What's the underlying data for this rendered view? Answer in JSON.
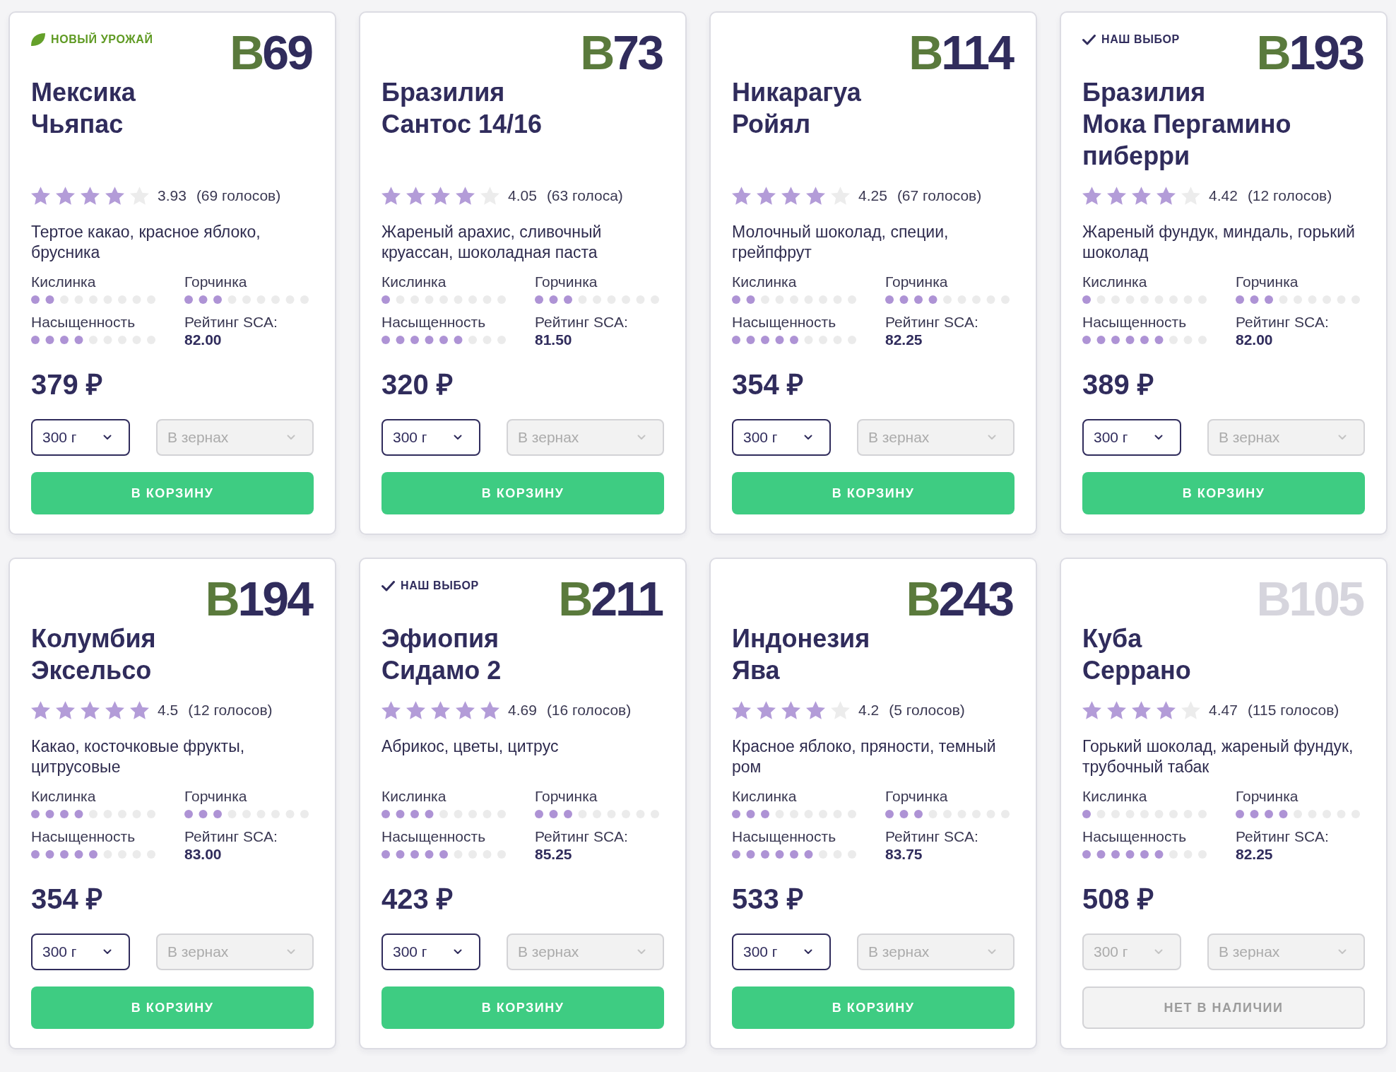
{
  "products": [
    {
      "badge": {
        "kind": "new_harvest",
        "label": "НОВЫЙ УРОЖАЙ"
      },
      "series": "B",
      "number": "69",
      "country": "Мексика",
      "name": "Чьяпас",
      "stars": 4,
      "rating": "3.93",
      "votes": "(69 голосов)",
      "description": "Тертое какао, красное яблоко, брусника",
      "attributes": [
        {
          "kind": "meter",
          "label": "Кислинка",
          "level": 0.2222
        },
        {
          "kind": "meter",
          "label": "Горчинка",
          "level": 0.3333
        },
        {
          "kind": "meter",
          "label": "Насыщенность",
          "level": 0.4444
        },
        {
          "kind": "score",
          "label": "Рейтинг SCA:",
          "value": "82.00"
        }
      ],
      "price": "379 ₽",
      "dropdowns": [
        {
          "kind": "weight",
          "value": "300 г",
          "disabled": false
        },
        {
          "kind": "grind",
          "value": "В зернах",
          "disabled": true
        }
      ],
      "in_stock": true,
      "button": "В КОРЗИНУ"
    },
    {
      "series": "B",
      "number": "73",
      "country": "Бразилия",
      "name": "Сантос 14/16",
      "stars": 4,
      "rating": "4.05",
      "votes": "(63 голоса)",
      "description": "Жареный арахис, сливочный круассан, шоколадная паста",
      "attributes": [
        {
          "kind": "meter",
          "label": "Кислинка",
          "level": 0.1111
        },
        {
          "kind": "meter",
          "label": "Горчинка",
          "level": 0.3333
        },
        {
          "kind": "meter",
          "label": "Насыщенность",
          "level": 0.6667
        },
        {
          "kind": "score",
          "label": "Рейтинг SCA:",
          "value": "81.50"
        }
      ],
      "price": "320 ₽",
      "dropdowns": [
        {
          "kind": "weight",
          "value": "300 г",
          "disabled": false
        },
        {
          "kind": "grind",
          "value": "В зернах",
          "disabled": true
        }
      ],
      "in_stock": true,
      "button": "В КОРЗИНУ"
    },
    {
      "series": "B",
      "number": "114",
      "country": "Никарагуа",
      "name": "Ройял",
      "stars": 4,
      "rating": "4.25",
      "votes": "(67 голосов)",
      "description": "Молочный шоколад, специи, грейпфрут",
      "attributes": [
        {
          "kind": "meter",
          "label": "Кислинка",
          "level": 0.2222
        },
        {
          "kind": "meter",
          "label": "Горчинка",
          "level": 0.4444
        },
        {
          "kind": "meter",
          "label": "Насыщенность",
          "level": 0.5556
        },
        {
          "kind": "score",
          "label": "Рейтинг SCA:",
          "value": "82.25"
        }
      ],
      "price": "354 ₽",
      "dropdowns": [
        {
          "kind": "weight",
          "value": "300 г",
          "disabled": false
        },
        {
          "kind": "grind",
          "value": "В зернах",
          "disabled": true
        }
      ],
      "in_stock": true,
      "button": "В КОРЗИНУ"
    },
    {
      "badge": {
        "kind": "our_pick",
        "label": "НАШ ВЫБОР"
      },
      "series": "B",
      "number": "193",
      "country": "Бразилия",
      "name": "Мока Пергамино пиберри",
      "stars": 4,
      "rating": "4.42",
      "votes": "(12 голосов)",
      "description": "Жареный фундук, миндаль, горький шоколад",
      "attributes": [
        {
          "kind": "meter",
          "label": "Кислинка",
          "level": 0.1111
        },
        {
          "kind": "meter",
          "label": "Горчинка",
          "level": 0.3333
        },
        {
          "kind": "meter",
          "label": "Насыщенность",
          "level": 0.6667
        },
        {
          "kind": "score",
          "label": "Рейтинг SCA:",
          "value": "82.00"
        }
      ],
      "price": "389 ₽",
      "dropdowns": [
        {
          "kind": "weight",
          "value": "300 г",
          "disabled": false
        },
        {
          "kind": "grind",
          "value": "В зернах",
          "disabled": true
        }
      ],
      "in_stock": true,
      "button": "В КОРЗИНУ"
    },
    {
      "series": "B",
      "number": "194",
      "country": "Колумбия",
      "name": "Эксельсо",
      "stars": 5,
      "rating": "4.5",
      "votes": "(12 голосов)",
      "description": "Какао, косточковые фрукты, цитрусовые",
      "attributes": [
        {
          "kind": "meter",
          "label": "Кислинка",
          "level": 0.4444
        },
        {
          "kind": "meter",
          "label": "Горчинка",
          "level": 0.3333
        },
        {
          "kind": "meter",
          "label": "Насыщенность",
          "level": 0.5556
        },
        {
          "kind": "score",
          "label": "Рейтинг SCA:",
          "value": "83.00"
        }
      ],
      "price": "354 ₽",
      "dropdowns": [
        {
          "kind": "weight",
          "value": "300 г",
          "disabled": false
        },
        {
          "kind": "grind",
          "value": "В зернах",
          "disabled": true
        }
      ],
      "in_stock": true,
      "button": "В КОРЗИНУ"
    },
    {
      "badge": {
        "kind": "our_pick",
        "label": "НАШ ВЫБОР"
      },
      "series": "B",
      "number": "211",
      "country": "Эфиопия",
      "name": "Сидамо 2",
      "stars": 5,
      "rating": "4.69",
      "votes": "(16 голосов)",
      "description": "Абрикос, цветы, цитрус",
      "attributes": [
        {
          "kind": "meter",
          "label": "Кислинка",
          "level": 0.4444
        },
        {
          "kind": "meter",
          "label": "Горчинка",
          "level": 0.3333
        },
        {
          "kind": "meter",
          "label": "Насыщенность",
          "level": 0.5556
        },
        {
          "kind": "score",
          "label": "Рейтинг SCA:",
          "value": "85.25"
        }
      ],
      "price": "423 ₽",
      "dropdowns": [
        {
          "kind": "weight",
          "value": "300 г",
          "disabled": false
        },
        {
          "kind": "grind",
          "value": "В зернах",
          "disabled": true
        }
      ],
      "in_stock": true,
      "button": "В КОРЗИНУ"
    },
    {
      "series": "B",
      "number": "243",
      "country": "Индонезия",
      "name": "Ява",
      "stars": 4,
      "rating": "4.2",
      "votes": "(5 голосов)",
      "description": "Красное яблоко, пряности, темный ром",
      "attributes": [
        {
          "kind": "meter",
          "label": "Кислинка",
          "level": 0.3333
        },
        {
          "kind": "meter",
          "label": "Горчинка",
          "level": 0.3333
        },
        {
          "kind": "meter",
          "label": "Насыщенность",
          "level": 0.6667
        },
        {
          "kind": "score",
          "label": "Рейтинг SCA:",
          "value": "83.75"
        }
      ],
      "price": "533 ₽",
      "dropdowns": [
        {
          "kind": "weight",
          "value": "300 г",
          "disabled": false
        },
        {
          "kind": "grind",
          "value": "В зернах",
          "disabled": true
        }
      ],
      "in_stock": true,
      "button": "В КОРЗИНУ"
    },
    {
      "series": "B",
      "number": "105",
      "country": "Куба",
      "name": "Серрано",
      "stars": 4,
      "rating": "4.47",
      "votes": "(115 голосов)",
      "description": "Горький шоколад, жареный фундук, трубочный табак",
      "attributes": [
        {
          "kind": "meter",
          "label": "Кислинка",
          "level": 0.1111
        },
        {
          "kind": "meter",
          "label": "Горчинка",
          "level": 0.4444
        },
        {
          "kind": "meter",
          "label": "Насыщенность",
          "level": 0.6667
        },
        {
          "kind": "score",
          "label": "Рейтинг SCA:",
          "value": "82.25"
        }
      ],
      "price": "508 ₽",
      "dropdowns": [
        {
          "kind": "weight",
          "value": "300 г",
          "disabled": true
        },
        {
          "kind": "grind",
          "value": "В зернах",
          "disabled": true
        }
      ],
      "in_stock": false,
      "button": "НЕТ В НАЛИЧИИ"
    }
  ]
}
